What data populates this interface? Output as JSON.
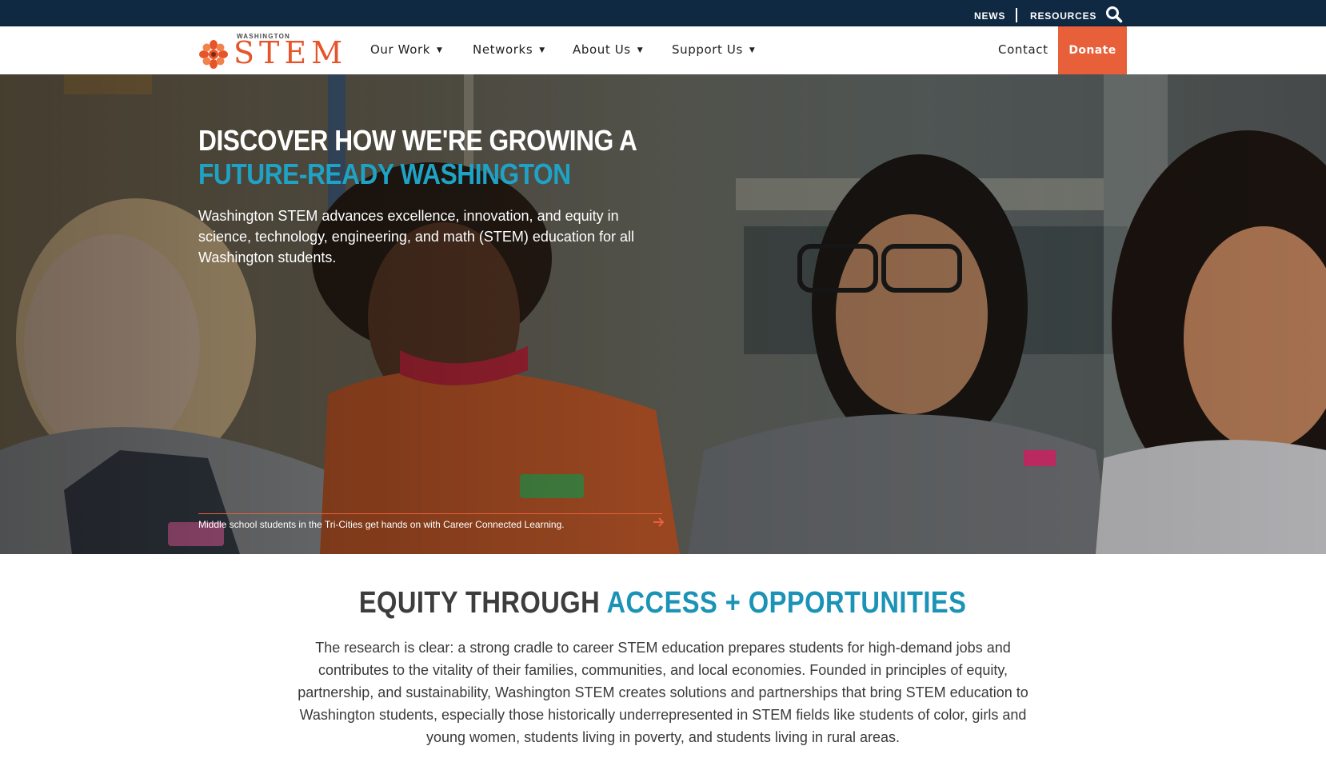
{
  "utility": {
    "news": "NEWS",
    "resources": "RESOURCES"
  },
  "logo": {
    "small_text": "WASHINGTON",
    "word": "STEM"
  },
  "nav": {
    "items": [
      {
        "label": "Our Work"
      },
      {
        "label": "Networks"
      },
      {
        "label": "About Us"
      },
      {
        "label": "Support Us"
      }
    ],
    "contact": "Contact",
    "donate": "Donate"
  },
  "hero": {
    "headline_line1": "DISCOVER HOW WE'RE GROWING A",
    "headline_line2": "FUTURE-READY WASHINGTON",
    "body": "Washington STEM advances excellence, innovation, and equity in science, technology, engineering, and math (STEM) education for all Washington students.",
    "caption": "Middle school students in the Tri-Cities get hands on with Career Connected Learning."
  },
  "intro": {
    "title_a": "EQUITY THROUGH ",
    "title_b": "ACCESS + OPPORTUNITIES",
    "body": "The research is clear: a strong cradle to career STEM education prepares students for high-demand jobs and contributes to the vitality of their families, communities, and local economies. Founded in principles of equity, partnership, and sustainability, Washington STEM creates solutions and partnerships that bring STEM education to Washington students, especially those historically underrepresented in STEM fields like students of color, girls and young women, students living in poverty, and students living in rural areas."
  },
  "colors": {
    "navy": "#0f2942",
    "orange": "#e8603a",
    "teal": "#1ea3c6"
  },
  "icons": {
    "search": "search-icon",
    "caret": "caret-down-icon",
    "arrow": "arrow-right-icon",
    "logo_mark": "stem-flower-logo-icon"
  }
}
